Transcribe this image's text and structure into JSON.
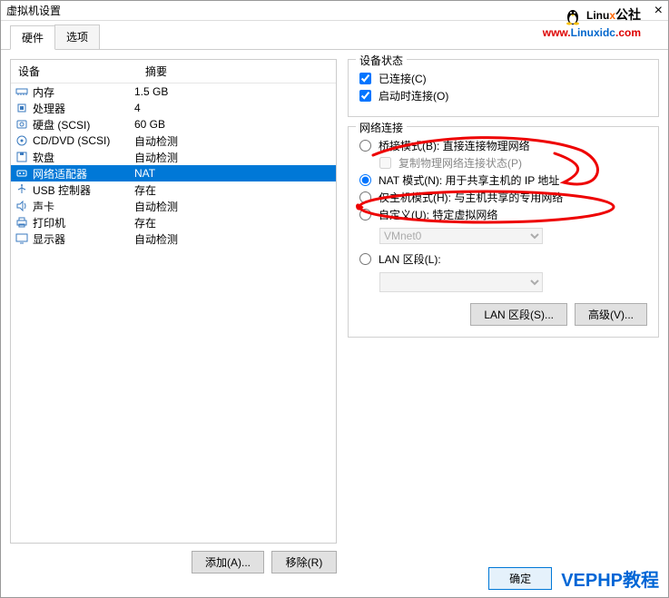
{
  "title": "虚拟机设置",
  "logo": {
    "text_black": "Linu",
    "text_orange": "x",
    "suffix": "公社",
    "url_prefix": "www.",
    "url_main": "Linuxidc",
    "url_suffix": ".com"
  },
  "tabs": {
    "hardware": "硬件",
    "options": "选项"
  },
  "list_header": {
    "device": "设备",
    "summary": "摘要"
  },
  "devices": [
    {
      "name": "内存",
      "summary": "1.5 GB",
      "icon": "memory"
    },
    {
      "name": "处理器",
      "summary": "4",
      "icon": "cpu"
    },
    {
      "name": "硬盘 (SCSI)",
      "summary": "60 GB",
      "icon": "disk"
    },
    {
      "name": "CD/DVD (SCSI)",
      "summary": "自动检测",
      "icon": "cd"
    },
    {
      "name": "软盘",
      "summary": "自动检测",
      "icon": "floppy"
    },
    {
      "name": "网络适配器",
      "summary": "NAT",
      "icon": "net",
      "selected": true
    },
    {
      "name": "USB 控制器",
      "summary": "存在",
      "icon": "usb"
    },
    {
      "name": "声卡",
      "summary": "自动检测",
      "icon": "sound"
    },
    {
      "name": "打印机",
      "summary": "存在",
      "icon": "printer"
    },
    {
      "name": "显示器",
      "summary": "自动检测",
      "icon": "display"
    }
  ],
  "buttons": {
    "add": "添加(A)...",
    "remove": "移除(R)",
    "lan_segment": "LAN 区段(S)...",
    "advanced": "高级(V)...",
    "ok": "确定"
  },
  "status_group": {
    "title": "设备状态",
    "connected": "已连接(C)",
    "connect_on_start": "启动时连接(O)"
  },
  "net_group": {
    "title": "网络连接",
    "bridged": "桥接模式(B): 直接连接物理网络",
    "replicate": "复制物理网络连接状态(P)",
    "nat": "NAT 模式(N): 用于共享主机的 IP 地址",
    "host_only": "仅主机模式(H): 与主机共享的专用网络",
    "custom": "自定义(U): 特定虚拟网络",
    "vmnet": "VMnet0",
    "lan": "LAN 区段(L):"
  },
  "watermark": "VEPHP教程"
}
